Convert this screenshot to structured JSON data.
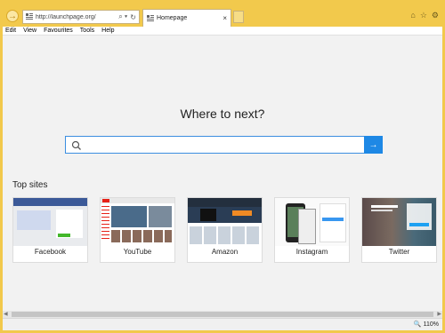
{
  "browser": {
    "address_url": "http://launchpage.org/",
    "tab_title": "Homepage",
    "tab_close": "×",
    "search_tool": "⌕ ▾",
    "refresh": "↻",
    "forward_glyph": "→"
  },
  "menu": {
    "items": [
      "Edit",
      "View",
      "Favourites",
      "Tools",
      "Help"
    ]
  },
  "main": {
    "heading": "Where to next?",
    "search_placeholder": "",
    "go_glyph": "→",
    "top_sites_label": "Top sites",
    "tiles": [
      {
        "name": "Facebook"
      },
      {
        "name": "YouTube"
      },
      {
        "name": "Amazon"
      },
      {
        "name": "Instagram"
      },
      {
        "name": "Twitter"
      }
    ]
  },
  "status": {
    "zoom": "110%"
  },
  "colors": {
    "frame": "#f2c94c",
    "accent": "#1e88e5"
  }
}
